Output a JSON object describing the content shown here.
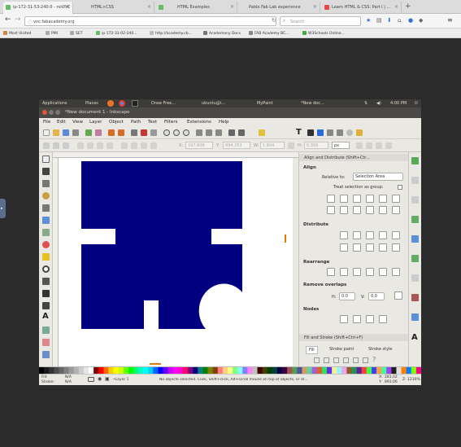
{
  "browser": {
    "tabs": [
      {
        "title": "ip-172-31-53-240:0 - noVNC",
        "active": true
      },
      {
        "title": "HTML+CSS",
        "active": false
      },
      {
        "title": "HTML Examples",
        "active": false
      },
      {
        "title": "Pablo Fab Lab experience",
        "active": false
      },
      {
        "title": "Learn HTML & CSS: Part I | ...",
        "active": false
      }
    ],
    "new_tab": "+",
    "url": "vnc.fabacademy.org",
    "search_placeholder": "Search",
    "bookmarks": [
      "Most Visited",
      "PMI",
      "SET",
      "ip-172-31-02-240...",
      "http://academy.cb...",
      "Academany Docs",
      "FAB Academy BC...",
      "W3Schools Online..."
    ]
  },
  "side_tab": "▸",
  "desktop_panel": {
    "applications": "Applications",
    "places": "Places",
    "tasks": [
      "Draw Free...",
      "ubuntu@i...",
      "MyPaint",
      "*New doc..."
    ],
    "clock": "4:00 PM"
  },
  "inkscape": {
    "window_title": "*New document 1 - Inkscape",
    "menu": [
      "File",
      "Edit",
      "View",
      "Layer",
      "Object",
      "Path",
      "Text",
      "Filters",
      "Extensions",
      "Help"
    ],
    "coords": {
      "x_label": "X:",
      "x": "197.606",
      "y_label": "Y:",
      "y": "694.253",
      "w_label": "W:",
      "w": "1.804",
      "h_label": "H:",
      "h": "0.358",
      "unit": "px"
    },
    "align_panel": {
      "header": "Align and Distribute (Shift+Ctr...",
      "align_title": "Align",
      "relative_to_label": "Relative to:",
      "relative_to_value": "Selection Area",
      "treat_group_label": "Treat selection as group:",
      "distribute_title": "Distribute",
      "rearrange_title": "Rearrange",
      "remove_overlaps_title": "Remove overlaps",
      "h_label": "H:",
      "h_value": "0.0",
      "v_label": "V:",
      "v_value": "0.0",
      "nodes_title": "Nodes"
    },
    "fill_stroke": {
      "header": "Fill and Stroke (Shift+Ctrl+F)",
      "tabs": [
        "Fill",
        "Stroke paint",
        "Stroke style"
      ]
    },
    "status": {
      "fill_label": "Fill:",
      "fill_value": "N/A",
      "stroke_label": "Stroke:",
      "stroke_value": "N/A",
      "layer": "•Layer 1",
      "message": "No objects selected. Click, Shift+click, Alt+scroll mouse on top of objects, or dr...",
      "cursor_x_label": "X:",
      "cursor_x": "281.02",
      "cursor_y_label": "Y:",
      "cursor_y": "893.06",
      "zoom_label": "Z:",
      "zoom": "1230%"
    }
  },
  "colors": {
    "shape": "#000080",
    "accent": "#e07a00",
    "desktop": "#2b2b2b"
  }
}
